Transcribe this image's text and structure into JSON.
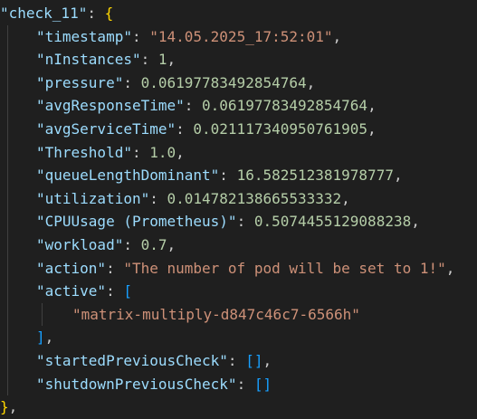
{
  "block_key": "\"check_11\"",
  "lines": {
    "timestamp": {
      "key": "\"timestamp\"",
      "value": "\"14.05.2025_17:52:01\""
    },
    "nInstances": {
      "key": "\"nInstances\"",
      "value": "1"
    },
    "pressure": {
      "key": "\"pressure\"",
      "value": "0.06197783492854764"
    },
    "avgResponseTime": {
      "key": "\"avgResponseTime\"",
      "value": "0.06197783492854764"
    },
    "avgServiceTime": {
      "key": "\"avgServiceTime\"",
      "value": "0.021117340950761905"
    },
    "Threshold": {
      "key": "\"Threshold\"",
      "value": "1.0"
    },
    "queueLengthDominant": {
      "key": "\"queueLengthDominant\"",
      "value": "16.582512381978777"
    },
    "utilization": {
      "key": "\"utilization\"",
      "value": "0.014782138665533332"
    },
    "CPUUsage": {
      "key": "\"CPUUsage (Prometheus)\"",
      "value": "0.5074455129088238"
    },
    "workload": {
      "key": "\"workload\"",
      "value": "0.7"
    },
    "action": {
      "key": "\"action\"",
      "value": "\"The number of pod will be set to 1!\""
    },
    "active": {
      "key": "\"active\"",
      "items": [
        "\"matrix-multiply-d847c46c7-6566h\""
      ]
    },
    "startedPreviousCheck": {
      "key": "\"startedPreviousCheck\""
    },
    "shutdownPreviousCheck": {
      "key": "\"shutdownPreviousCheck\""
    }
  },
  "colors": {
    "background": "#1f1f1f",
    "key": "#9cdcfe",
    "string": "#ce9178",
    "number": "#b5cea8",
    "brace": "#ffd700",
    "bracket": "#179fff"
  }
}
